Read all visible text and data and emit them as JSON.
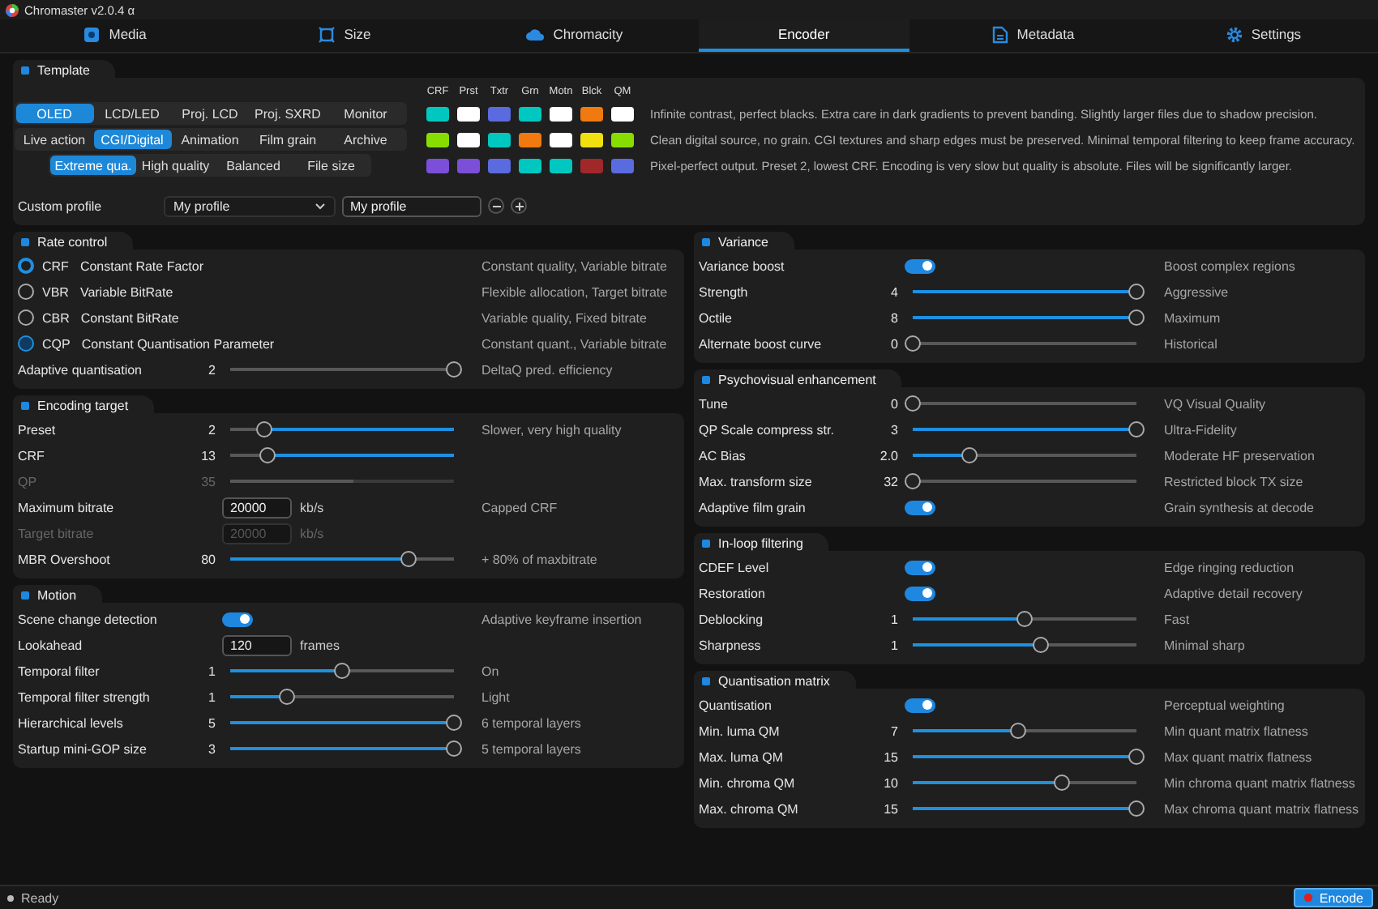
{
  "window": {
    "title": "Chromaster v2.0.4 α"
  },
  "tabs": [
    {
      "label": "Media",
      "selected": false
    },
    {
      "label": "Size",
      "selected": false
    },
    {
      "label": "Chromacity",
      "selected": false
    },
    {
      "label": "Encoder",
      "selected": true
    },
    {
      "label": "Metadata",
      "selected": false
    },
    {
      "label": "Settings",
      "selected": false
    }
  ],
  "template": {
    "title": "Template",
    "presets": [
      {
        "options": [
          {
            "label": "OLED",
            "selected": true
          },
          {
            "label": "LCD/LED",
            "selected": false
          },
          {
            "label": "Proj. LCD",
            "selected": false
          },
          {
            "label": "Proj. SXRD",
            "selected": false
          },
          {
            "label": "Monitor",
            "selected": false
          }
        ]
      },
      {
        "options": [
          {
            "label": "Live action",
            "selected": false
          },
          {
            "label": "CGI/Digital",
            "selected": true
          },
          {
            "label": "Animation",
            "selected": false
          },
          {
            "label": "Film grain",
            "selected": false
          },
          {
            "label": "Archive",
            "selected": false
          }
        ]
      },
      {
        "options": [
          {
            "label": "Extreme qua.",
            "selected": true
          },
          {
            "label": "High quality",
            "selected": false
          },
          {
            "label": "Balanced",
            "selected": false
          },
          {
            "label": "File size",
            "selected": false
          }
        ]
      }
    ],
    "swatch_headers": [
      "CRF",
      "Prst",
      "Txtr",
      "Grn",
      "Motn",
      "Blck",
      "QM"
    ],
    "swatch_rows": [
      {
        "swatches": [
          {
            "color": "#00c8c0"
          },
          {
            "color": "#ffffff"
          },
          {
            "color": "#5a6be0"
          },
          {
            "color": "#00c8c0"
          },
          {
            "color": "#ffffff"
          },
          {
            "color": "#f07a10"
          },
          {
            "color": "#ffffff"
          }
        ],
        "description": "Infinite contrast, perfect blacks. Extra care in dark gradients to prevent banding. Slightly larger files due to shadow precision."
      },
      {
        "swatches": [
          {
            "color": "#88dd00"
          },
          {
            "color": "#ffffff"
          },
          {
            "color": "#00c8c0"
          },
          {
            "color": "#f07a10"
          },
          {
            "color": "#ffffff"
          },
          {
            "color": "#f0e010"
          },
          {
            "color": "#88dd00"
          }
        ],
        "description": "Clean digital source, no grain. CGI textures and sharp edges must be preserved. Minimal temporal filtering to keep frame accuracy."
      },
      {
        "swatches": [
          {
            "color": "#7b4fd8"
          },
          {
            "color": "#7b4fd8"
          },
          {
            "color": "#5a6be0"
          },
          {
            "color": "#00c8c0"
          },
          {
            "color": "#00c8c0"
          },
          {
            "color": "#a02828"
          },
          {
            "color": "#5a6be0"
          }
        ],
        "description": "Pixel-perfect output. Preset 2, lowest CRF. Encoding is very slow but quality is absolute. Files will be significantly larger."
      }
    ],
    "custom_profile": {
      "label": "Custom profile",
      "selection": "My profile",
      "name": "My profile"
    }
  },
  "columns": [
    {
      "panels": [
        {
          "title": "Rate control",
          "rows": [
            {
              "kind": "radio",
              "code": "CRF",
              "label": "Constant Rate Factor",
              "selected": true,
              "focused": false,
              "description": "Constant quality, Variable bitrate"
            },
            {
              "kind": "radio",
              "code": "VBR",
              "label": "Variable BitRate",
              "selected": false,
              "focused": false,
              "description": "Flexible allocation, Target bitrate"
            },
            {
              "kind": "radio",
              "code": "CBR",
              "label": "Constant BitRate",
              "selected": false,
              "focused": false,
              "description": "Variable quality, Fixed bitrate"
            },
            {
              "kind": "radio",
              "code": "CQP",
              "label": "Constant Quantisation Parameter",
              "selected": false,
              "focused": true,
              "description": "Constant quant., Variable bitrate"
            },
            {
              "kind": "slider-plain",
              "label": "Adaptive quantisation",
              "value": "2",
              "level": 1,
              "disabled": false,
              "description": "DeltaQ pred. efficiency"
            }
          ]
        },
        {
          "title": "Encoding target",
          "rows": [
            {
              "kind": "slider-reversed",
              "label": "Preset",
              "value": "2",
              "level": 0.15,
              "disabled": false,
              "description": "Slower, very high quality"
            },
            {
              "kind": "slider-reversed",
              "label": "CRF",
              "value": "13",
              "level": 0.17,
              "disabled": false
            },
            {
              "kind": "slider",
              "label": "QP",
              "value": "35",
              "level": 0.55,
              "disabled": true
            },
            {
              "kind": "number",
              "label": "Maximum bitrate",
              "value": "20000",
              "unit": "kb/s",
              "disabled": false,
              "description": "Capped CRF"
            },
            {
              "kind": "number",
              "label": "Target bitrate",
              "value": "20000",
              "unit": "kb/s",
              "disabled": true
            },
            {
              "kind": "slider",
              "label": "MBR Overshoot",
              "value": "80",
              "level": 0.8,
              "disabled": false,
              "description": "+ 80% of maxbitrate"
            }
          ]
        },
        {
          "title": "Motion",
          "rows": [
            {
              "kind": "toggle",
              "label": "Scene change detection",
              "on": true,
              "description": "Adaptive keyframe insertion"
            },
            {
              "kind": "number",
              "label": "Lookahead",
              "value": "120",
              "unit": "frames",
              "disabled": false
            },
            {
              "kind": "slider",
              "label": "Temporal filter",
              "value": "1",
              "level": 0.5,
              "disabled": false,
              "description": "On"
            },
            {
              "kind": "slider",
              "label": "Temporal filter strength",
              "value": "1",
              "level": 0.25,
              "disabled": false,
              "description": "Light"
            },
            {
              "kind": "slider",
              "label": "Hierarchical levels",
              "value": "5",
              "level": 1,
              "disabled": false,
              "description": "6 temporal layers"
            },
            {
              "kind": "slider",
              "label": "Startup mini-GOP size",
              "value": "3",
              "level": 1,
              "disabled": false,
              "description": "5 temporal layers"
            }
          ]
        }
      ]
    },
    {
      "panels": [
        {
          "title": "Variance",
          "rows": [
            {
              "kind": "toggle",
              "label": "Variance boost",
              "on": true,
              "description": "Boost complex regions"
            },
            {
              "kind": "slider",
              "label": "Strength",
              "value": "4",
              "level": 1,
              "disabled": false,
              "description": "Aggressive"
            },
            {
              "kind": "slider",
              "label": "Octile",
              "value": "8",
              "level": 1,
              "disabled": false,
              "description": "Maximum"
            },
            {
              "kind": "slider",
              "label": "Alternate boost curve",
              "value": "0",
              "level": 0,
              "disabled": false,
              "description": "Historical"
            }
          ]
        },
        {
          "title": "Psychovisual enhancement",
          "rows": [
            {
              "kind": "slider",
              "label": "Tune",
              "value": "0",
              "level": 0,
              "disabled": false,
              "description": "VQ Visual Quality"
            },
            {
              "kind": "slider",
              "label": "QP Scale compress str.",
              "value": "3",
              "level": 1,
              "disabled": false,
              "description": "Ultra-Fidelity"
            },
            {
              "kind": "slider",
              "label": "AC Bias",
              "value": "2.0",
              "level": 0.25,
              "disabled": false,
              "description": "Moderate HF preservation"
            },
            {
              "kind": "slider",
              "label": "Max. transform size",
              "value": "32",
              "level": 0,
              "disabled": false,
              "description": "Restricted block TX size"
            },
            {
              "kind": "toggle",
              "label": "Adaptive film grain",
              "on": true,
              "description": "Grain synthesis at decode"
            }
          ]
        },
        {
          "title": "In-loop filtering",
          "rows": [
            {
              "kind": "toggle",
              "label": "CDEF Level",
              "on": true,
              "description": "Edge ringing reduction"
            },
            {
              "kind": "toggle",
              "label": "Restoration",
              "on": true,
              "description": "Adaptive detail recovery"
            },
            {
              "kind": "slider",
              "label": "Deblocking",
              "value": "1",
              "level": 0.5,
              "disabled": false,
              "description": "Fast"
            },
            {
              "kind": "slider",
              "label": "Sharpness",
              "value": "1",
              "level": 0.57,
              "disabled": false,
              "description": "Minimal sharp"
            }
          ]
        },
        {
          "title": "Quantisation matrix",
          "rows": [
            {
              "kind": "toggle",
              "label": "Quantisation",
              "on": true,
              "description": "Perceptual weighting"
            },
            {
              "kind": "slider",
              "label": "Min. luma QM",
              "value": "7",
              "level": 0.47,
              "disabled": false,
              "description": "Min quant matrix flatness"
            },
            {
              "kind": "slider",
              "label": "Max. luma QM",
              "value": "15",
              "level": 1,
              "disabled": false,
              "description": "Max quant matrix flatness"
            },
            {
              "kind": "slider",
              "label": "Min. chroma QM",
              "value": "10",
              "level": 0.67,
              "disabled": false,
              "description": "Min chroma quant matrix flatness"
            },
            {
              "kind": "slider",
              "label": "Max. chroma QM",
              "value": "15",
              "level": 1,
              "disabled": false,
              "description": "Max chroma quant matrix flatness"
            }
          ]
        }
      ]
    }
  ],
  "status_bar": {
    "text": "Ready",
    "button": "Encode"
  }
}
